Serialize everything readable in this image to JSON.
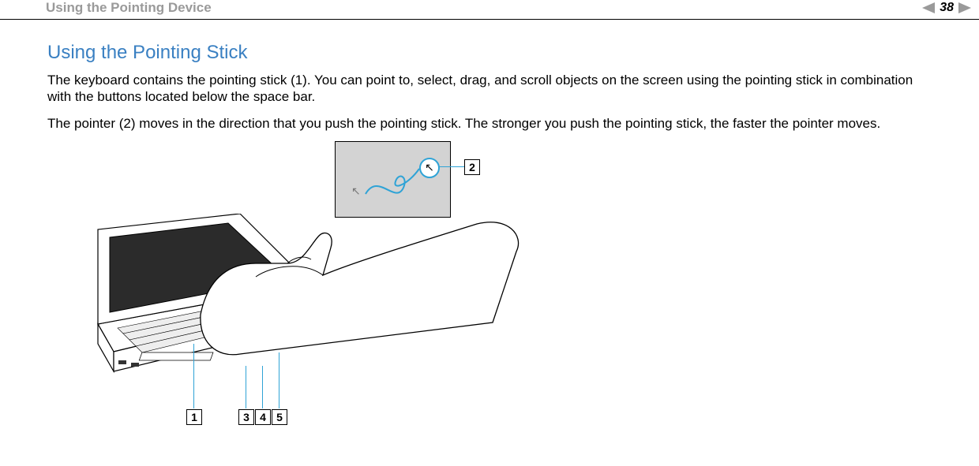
{
  "header": {
    "title": "Using the Pointing Device",
    "page_number": "38"
  },
  "section": {
    "heading": "Using the Pointing Stick",
    "para1": "The keyboard contains the pointing stick (1). You can point to, select, drag, and scroll objects on the screen using the pointing stick in combination with the buttons located below the space bar.",
    "para2": "The pointer (2) moves in the direction that you push the pointing stick. The stronger you push the pointing stick, the faster the pointer moves."
  },
  "callouts": {
    "c1": "1",
    "c2": "2",
    "c3": "3",
    "c4": "4",
    "c5": "5"
  }
}
